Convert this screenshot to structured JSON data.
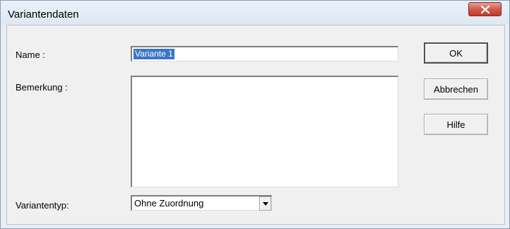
{
  "window": {
    "title": "Variantendaten"
  },
  "icons": {
    "close": "close-icon",
    "dropdown": "chevron-down-icon"
  },
  "form": {
    "name_label": "Name :",
    "name_value": "Variante 1",
    "remark_label": "Bemerkung :",
    "remark_value": "",
    "type_label": "Variantentyp:",
    "type_value": "Ohne Zuordnung"
  },
  "buttons": {
    "ok": "OK",
    "cancel": "Abbrechen",
    "help": "Hilfe"
  },
  "colors": {
    "selection": "#3a76c8",
    "close_button": "#c94b3c"
  }
}
